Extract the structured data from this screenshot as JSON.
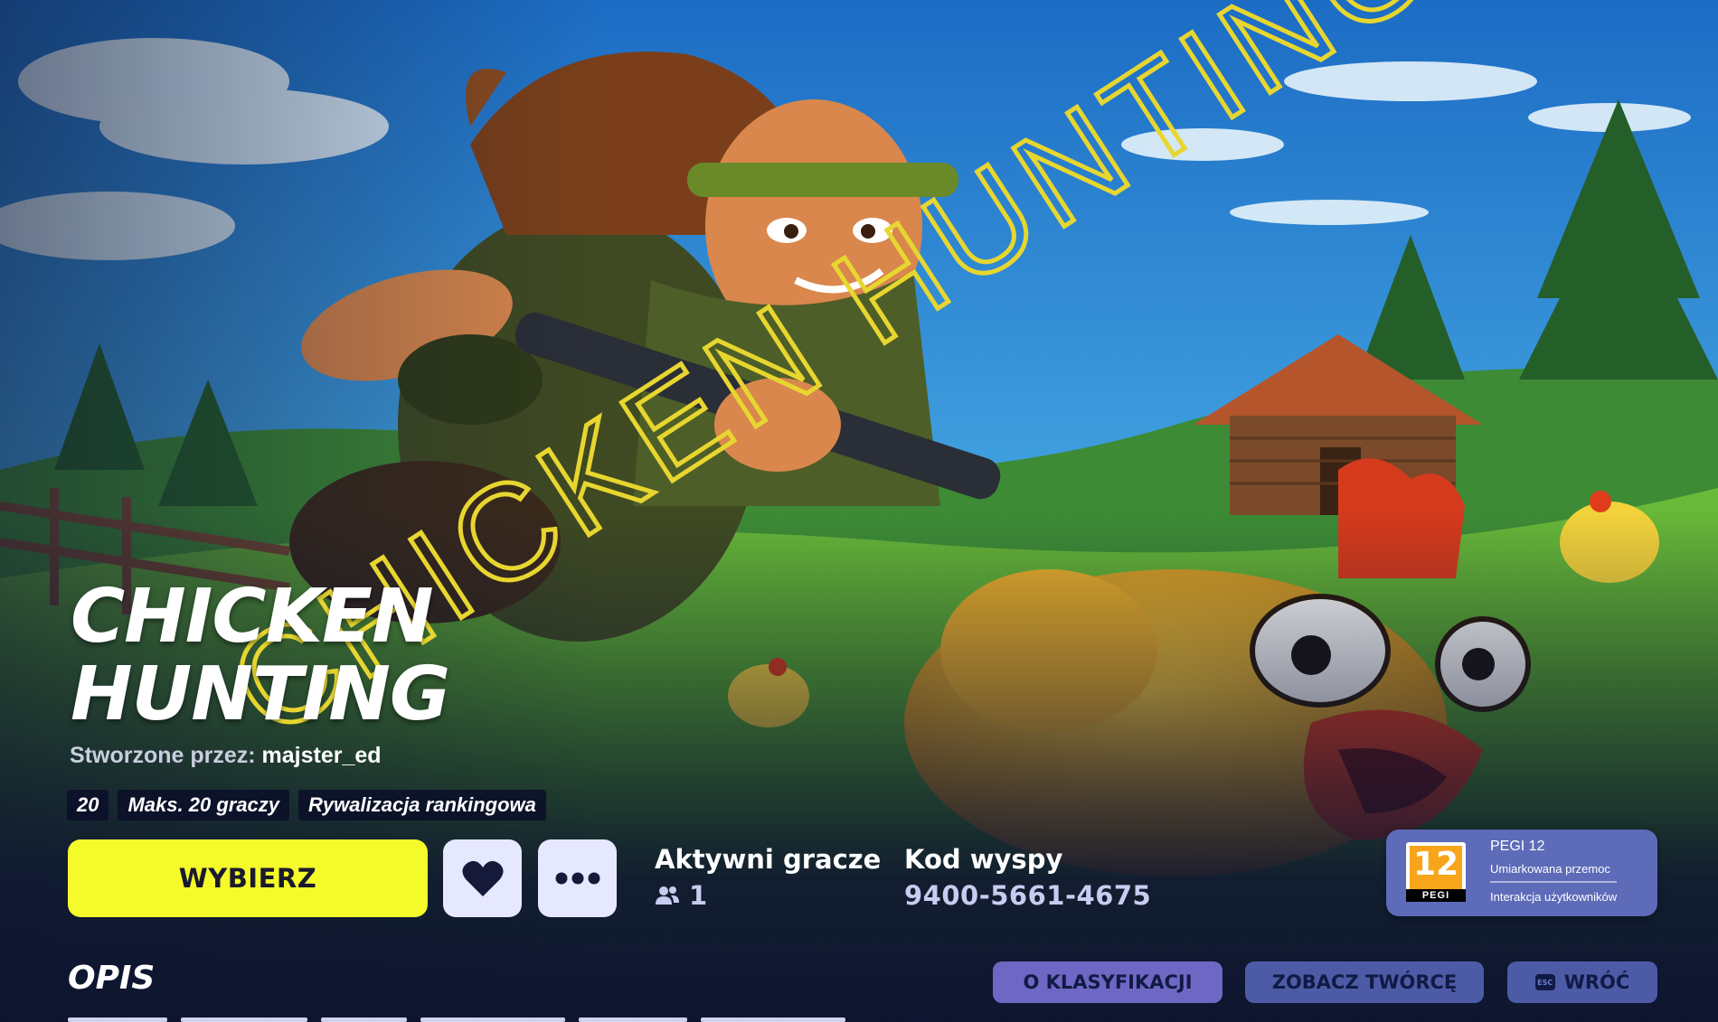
{
  "game": {
    "title_line1": "CHICKEN",
    "title_line2": "HUNTING",
    "art_title_text": "CHICKEN HUNTING",
    "creator_label": "Stworzone przez:",
    "creator_name": "majster_ed",
    "tags": [
      "20",
      "Maks. 20 graczy",
      "Rywalizacja rankingowa"
    ]
  },
  "actions": {
    "select_label": "WYBIERZ",
    "favorite_icon": "heart-icon",
    "more_icon": "more-dots-icon"
  },
  "stats": {
    "players_label": "Aktywni gracze",
    "players_value": "1",
    "players_icon": "users-icon",
    "island_label": "Kod wyspy",
    "island_code": "9400-5661-4675"
  },
  "rating": {
    "badge_number": "12",
    "badge_text": "PEGI",
    "title": "PEGI 12",
    "descriptors": [
      "Umiarkowana przemoc",
      "Interakcja użytkowników"
    ]
  },
  "description": {
    "heading": "OPIS"
  },
  "bottom_buttons": {
    "rating_info": "O KLASYFIKACJI",
    "view_creator": "ZOBACZ TWÓRCĘ",
    "back_key": "ESC",
    "back": "WRÓĆ"
  },
  "colors": {
    "accent_yellow": "#f5fb2a",
    "pegi_orange": "#f7a61b",
    "panel_blue": "#5d6bb8"
  }
}
